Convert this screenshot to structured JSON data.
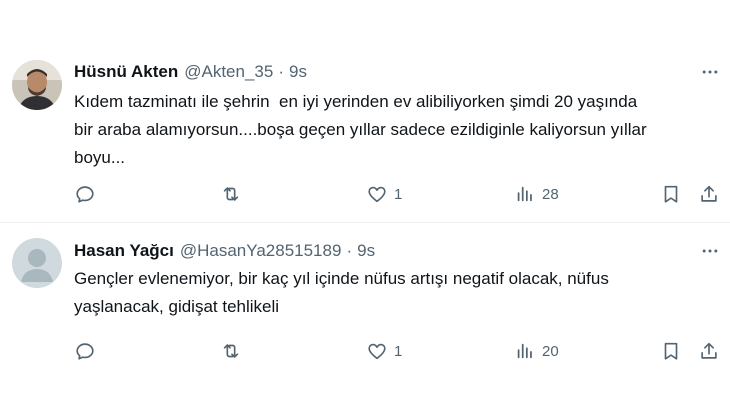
{
  "tweets": [
    {
      "name": "Hüsnü Akten",
      "handle": "@Akten_35",
      "separator": "·",
      "time": "9s",
      "text": "Kıdem tazminatı ile şehrin  en iyi yerinden ev alibiliyorken şimdi 20 yaşında\nbir araba alamıyorsun....boşa geçen yıllar sadece ezildiginle kaliyorsun yıllar\nboyu...",
      "reply_count": "",
      "retweet_count": "",
      "like_count": "1",
      "view_count": "28",
      "avatar": "photo-avatar"
    },
    {
      "name": "Hasan Yağcı",
      "handle": "@HasanYa28515189",
      "separator": "·",
      "time": "9s",
      "text": "Gençler evlenemiyor, bir kaç yıl içinde nüfus artışı negatif olacak, nüfus\nyaşlanacak, gidişat tehlikeli",
      "reply_count": "",
      "retweet_count": "",
      "like_count": "1",
      "view_count": "20",
      "avatar": "default-avatar"
    }
  ],
  "colors": {
    "text_primary": "#0f1419",
    "text_secondary": "#536471",
    "divider": "#eff3f4",
    "default_avatar_bg": "#cfd9de"
  },
  "icons": [
    "more-icon",
    "reply-icon",
    "retweet-icon",
    "like-icon",
    "views-icon",
    "bookmark-icon",
    "share-icon"
  ]
}
